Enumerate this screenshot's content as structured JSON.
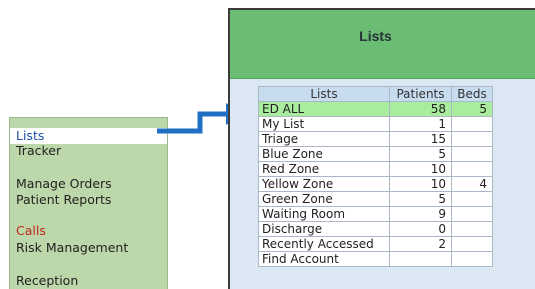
{
  "menu": {
    "items": [
      {
        "label": "Lists",
        "selected": true
      },
      {
        "label": "Tracker"
      },
      {
        "label": "Manage Orders"
      },
      {
        "label": "Patient Reports"
      },
      {
        "label": "Calls",
        "accent": "#c0261f"
      },
      {
        "label": "Risk Management"
      },
      {
        "label": "Reception"
      }
    ]
  },
  "arrow": {
    "icon": "arrow-right-icon",
    "color": "#1f6fc5"
  },
  "panel": {
    "title": "Lists",
    "header_color": "#6cbd74",
    "table": {
      "headers": [
        "Lists",
        "Patients",
        "Beds"
      ],
      "rows": [
        {
          "name": "ED ALL",
          "patients": "58",
          "beds": "5",
          "highlight": true
        },
        {
          "name": "My List",
          "patients": "1",
          "beds": ""
        },
        {
          "name": "Triage",
          "patients": "15",
          "beds": ""
        },
        {
          "name": "Blue Zone",
          "patients": "5",
          "beds": ""
        },
        {
          "name": "Red Zone",
          "patients": "10",
          "beds": ""
        },
        {
          "name": "Yellow Zone",
          "patients": "10",
          "beds": "4"
        },
        {
          "name": "Green Zone",
          "patients": "5",
          "beds": ""
        },
        {
          "name": "Waiting Room",
          "patients": "9",
          "beds": ""
        },
        {
          "name": "Discharge",
          "patients": "0",
          "beds": ""
        },
        {
          "name": "Recently Accessed",
          "patients": "2",
          "beds": ""
        },
        {
          "name": "Find Account",
          "patients": "",
          "beds": ""
        }
      ]
    }
  }
}
